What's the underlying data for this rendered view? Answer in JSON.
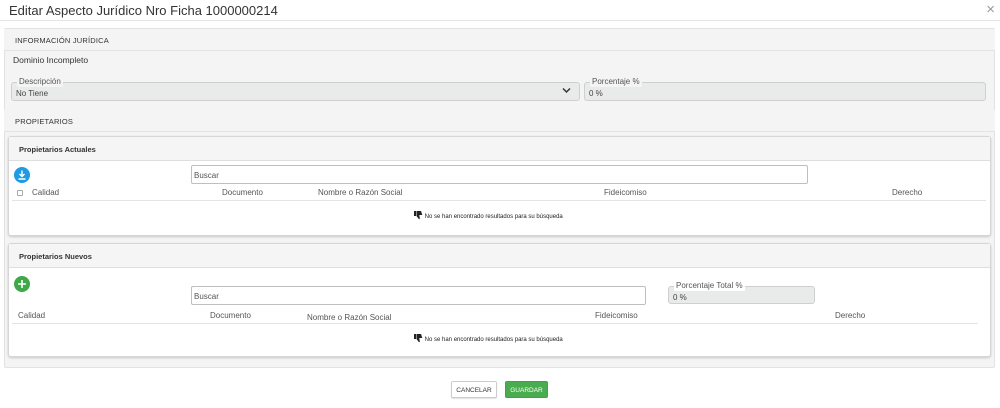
{
  "modal": {
    "title": "Editar Aspecto Jurídico Nro Ficha 1000000214",
    "close_glyph": "×"
  },
  "info_juridica": {
    "section_label": "INFORMACIÓN JURÍDICA",
    "status_text": "Dominio Incompleto",
    "descripcion": {
      "legend": "Descripción",
      "value": "No Tiene"
    },
    "porcentaje": {
      "legend": "Porcentaje %",
      "value": "0 %"
    }
  },
  "propietarios": {
    "section_label": "PROPIETARIOS",
    "actuales": {
      "title": "Propietarios Actuales",
      "add_icon": "download-icon",
      "search_placeholder": "Buscar",
      "columns": [
        "Calidad",
        "Documento",
        "Nombre o Razón Social",
        "Fideicomiso",
        "Derecho"
      ],
      "empty_message": "No se han encontrado resultados para su búsqueda"
    },
    "nuevos": {
      "title": "Propietarios Nuevos",
      "add_icon": "plus-icon",
      "search_placeholder": "Buscar",
      "porcentaje_total": {
        "legend": "Porcentaje Total %",
        "value": "0 %"
      },
      "columns": [
        "Calidad",
        "Documento",
        "Nombre o Razón Social",
        "Fideicomiso",
        "Derecho"
      ],
      "empty_message": "No se han encontrado resultados para su búsqueda"
    }
  },
  "footer": {
    "cancel_label": "CANCELAR",
    "save_label": "GUARDAR"
  },
  "colors": {
    "accent_blue": "#1e9be3",
    "accent_green": "#49ad4f"
  }
}
